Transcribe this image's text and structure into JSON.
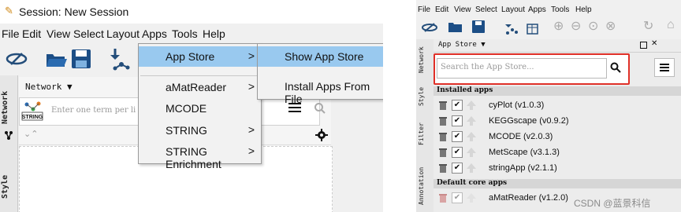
{
  "left": {
    "title": "Session: New Session",
    "menu": [
      "File",
      "Edit",
      "View",
      "Select",
      "Layout",
      "Apps",
      "Tools",
      "Help"
    ],
    "side_tabs": [
      "Network",
      "Style"
    ],
    "network_label": "Network",
    "search_placeholder": "Enter one term per li",
    "app_menu": [
      {
        "label": "App Store",
        "arrow": ">"
      },
      {
        "label": "aMatReader",
        "arrow": ">"
      },
      {
        "label": "MCODE",
        "arrow": ""
      },
      {
        "label": "STRING",
        "arrow": ">"
      },
      {
        "label": "STRING Enrichment",
        "arrow": ">"
      }
    ],
    "submenu": [
      "Show App Store",
      "Install Apps From File"
    ],
    "string_chip": "STRING"
  },
  "right": {
    "menu": [
      "File",
      "Edit",
      "View",
      "Select",
      "Layout",
      "Apps",
      "Tools",
      "Help"
    ],
    "side_tabs": [
      "Network",
      "Style",
      "Filter",
      "Annotation"
    ],
    "panel_title": "App Store",
    "search_placeholder": "Search the App Store...",
    "sections": {
      "installed": "Installed apps",
      "core": "Default core apps"
    },
    "installed_apps": [
      "cyPlot (v1.0.3)",
      "KEGGscape (v0.9.2)",
      "MCODE (v2.0.3)",
      "MetScape (v3.1.3)",
      "stringApp (v2.1.1)"
    ],
    "core_apps": [
      "aMatReader (v1.2.0)"
    ],
    "check": "✔"
  },
  "watermark": "CSDN @蓝景科信",
  "colors": {
    "highlight": "#99c9ef",
    "red_box": "#e03028"
  }
}
